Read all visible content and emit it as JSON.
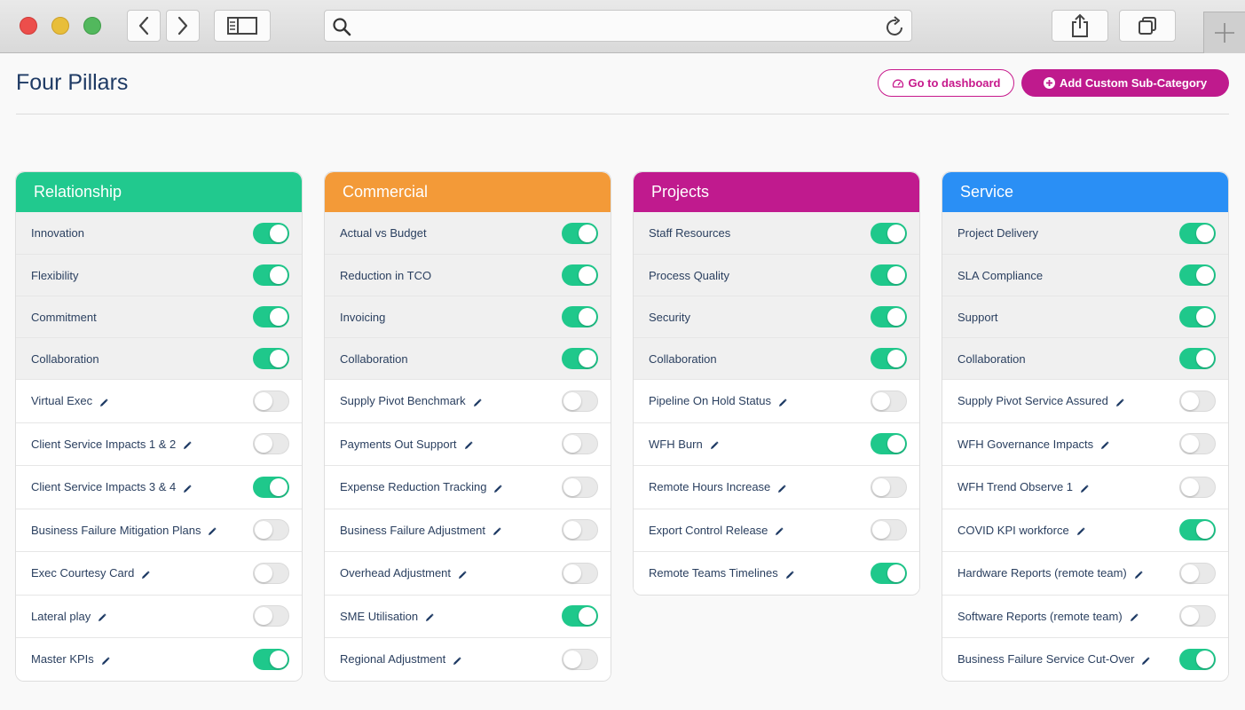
{
  "page": {
    "title": "Four Pillars",
    "dashboard_button": "Go to dashboard",
    "add_button": "Add Custom Sub-Category"
  },
  "colors": {
    "accent": "#bf1a8d",
    "toggle_on": "#1fc88b",
    "toggle_off": "#e9e9e9"
  },
  "pillars": [
    {
      "name": "Relationship",
      "color": "#21c98e",
      "items": [
        {
          "label": "Innovation",
          "custom": false,
          "enabled": true
        },
        {
          "label": "Flexibility",
          "custom": false,
          "enabled": true
        },
        {
          "label": "Commitment",
          "custom": false,
          "enabled": true
        },
        {
          "label": "Collaboration",
          "custom": false,
          "enabled": true
        },
        {
          "label": "Virtual Exec",
          "custom": true,
          "enabled": false
        },
        {
          "label": "Client Service Impacts 1 & 2",
          "custom": true,
          "enabled": false
        },
        {
          "label": "Client Service Impacts 3 & 4",
          "custom": true,
          "enabled": true
        },
        {
          "label": "Business Failure Mitigation Plans",
          "custom": true,
          "enabled": false
        },
        {
          "label": "Exec Courtesy Card",
          "custom": true,
          "enabled": false
        },
        {
          "label": "Lateral play",
          "custom": true,
          "enabled": false
        },
        {
          "label": "Master KPIs",
          "custom": true,
          "enabled": true
        }
      ]
    },
    {
      "name": "Commercial",
      "color": "#f39a38",
      "items": [
        {
          "label": "Actual vs Budget",
          "custom": false,
          "enabled": true
        },
        {
          "label": "Reduction in TCO",
          "custom": false,
          "enabled": true
        },
        {
          "label": "Invoicing",
          "custom": false,
          "enabled": true
        },
        {
          "label": "Collaboration",
          "custom": false,
          "enabled": true
        },
        {
          "label": "Supply Pivot Benchmark",
          "custom": true,
          "enabled": false
        },
        {
          "label": "Payments Out Support",
          "custom": true,
          "enabled": false
        },
        {
          "label": "Expense Reduction Tracking",
          "custom": true,
          "enabled": false
        },
        {
          "label": "Business Failure Adjustment",
          "custom": true,
          "enabled": false
        },
        {
          "label": "Overhead Adjustment",
          "custom": true,
          "enabled": false
        },
        {
          "label": "SME Utilisation",
          "custom": true,
          "enabled": true
        },
        {
          "label": "Regional Adjustment",
          "custom": true,
          "enabled": false
        }
      ]
    },
    {
      "name": "Projects",
      "color": "#c01a8e",
      "items": [
        {
          "label": "Staff Resources",
          "custom": false,
          "enabled": true
        },
        {
          "label": "Process Quality",
          "custom": false,
          "enabled": true
        },
        {
          "label": "Security",
          "custom": false,
          "enabled": true
        },
        {
          "label": "Collaboration",
          "custom": false,
          "enabled": true
        },
        {
          "label": "Pipeline On Hold Status",
          "custom": true,
          "enabled": false
        },
        {
          "label": "WFH Burn",
          "custom": true,
          "enabled": true
        },
        {
          "label": "Remote Hours Increase",
          "custom": true,
          "enabled": false
        },
        {
          "label": "Export Control Release",
          "custom": true,
          "enabled": false
        },
        {
          "label": "Remote Teams Timelines",
          "custom": true,
          "enabled": true
        }
      ]
    },
    {
      "name": "Service",
      "color": "#2a8ff5",
      "items": [
        {
          "label": "Project Delivery",
          "custom": false,
          "enabled": true
        },
        {
          "label": "SLA Compliance",
          "custom": false,
          "enabled": true
        },
        {
          "label": "Support",
          "custom": false,
          "enabled": true
        },
        {
          "label": "Collaboration",
          "custom": false,
          "enabled": true
        },
        {
          "label": "Supply Pivot Service Assured",
          "custom": true,
          "enabled": false
        },
        {
          "label": "WFH Governance Impacts",
          "custom": true,
          "enabled": false
        },
        {
          "label": "WFH Trend Observe 1",
          "custom": true,
          "enabled": false
        },
        {
          "label": "COVID KPI workforce",
          "custom": true,
          "enabled": true
        },
        {
          "label": "Hardware Reports (remote team)",
          "custom": true,
          "enabled": false
        },
        {
          "label": "Software Reports (remote team)",
          "custom": true,
          "enabled": false
        },
        {
          "label": "Business Failure Service Cut-Over",
          "custom": true,
          "enabled": true
        }
      ]
    }
  ]
}
